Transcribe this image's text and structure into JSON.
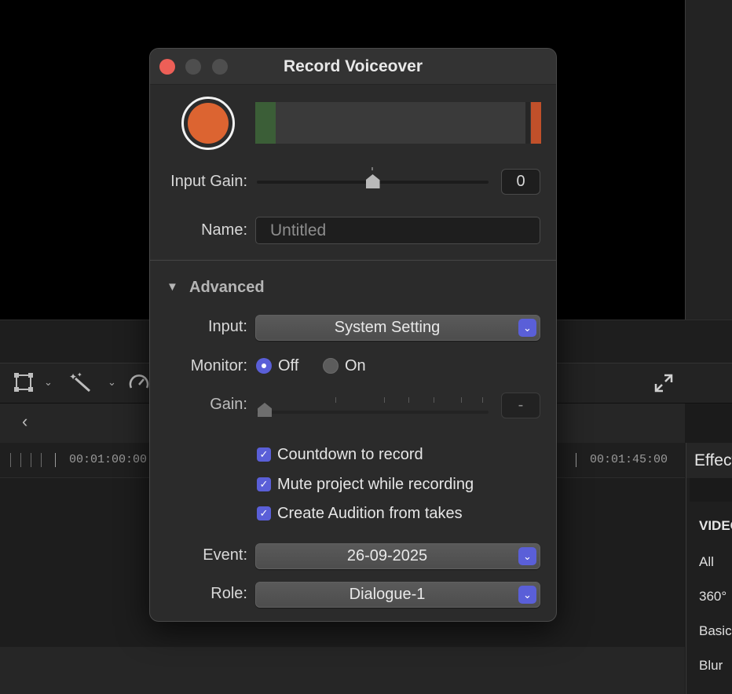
{
  "background": {
    "timeline": {
      "timecodes": [
        "00:01:00:00",
        "00:01:45:00"
      ]
    },
    "effects": {
      "title": "Effects",
      "category": "VIDEO",
      "items": [
        "All",
        "360°",
        "Basics",
        "Blur"
      ]
    }
  },
  "dialog": {
    "title": "Record Voiceover",
    "input_gain": {
      "label": "Input Gain:",
      "value": "0",
      "level": 0.5
    },
    "name": {
      "label": "Name:",
      "placeholder": "Untitled",
      "value": ""
    },
    "advanced": {
      "label": "Advanced",
      "expanded": true,
      "input": {
        "label": "Input:",
        "value": "System Setting"
      },
      "monitor": {
        "label": "Monitor:",
        "options": [
          "Off",
          "On"
        ],
        "selected": "Off"
      },
      "gain": {
        "label": "Gain:",
        "value": "-",
        "level": 0,
        "enabled": false
      },
      "checkboxes": [
        {
          "label": "Countdown to record",
          "checked": true
        },
        {
          "label": "Mute project while recording",
          "checked": true
        },
        {
          "label": "Create Audition from takes",
          "checked": true
        }
      ],
      "event": {
        "label": "Event:",
        "value": "26-09-2025"
      },
      "role": {
        "label": "Role:",
        "value": "Dialogue-1"
      }
    }
  },
  "colors": {
    "record": "#dc6431",
    "accent": "#5a5fd8",
    "meter_green": "#3b5e37",
    "meter_red": "#c0502a",
    "close": "#ed5f57"
  },
  "icons": {
    "transform": "transform-icon",
    "enhance": "magic-wand-icon",
    "retime": "speedometer-icon",
    "fullscreen": "fullscreen-icon",
    "back": "chevron-left-icon",
    "record": "record-icon",
    "disclosure": "disclosure-triangle-icon",
    "popup": "popup-chevron-icon"
  }
}
